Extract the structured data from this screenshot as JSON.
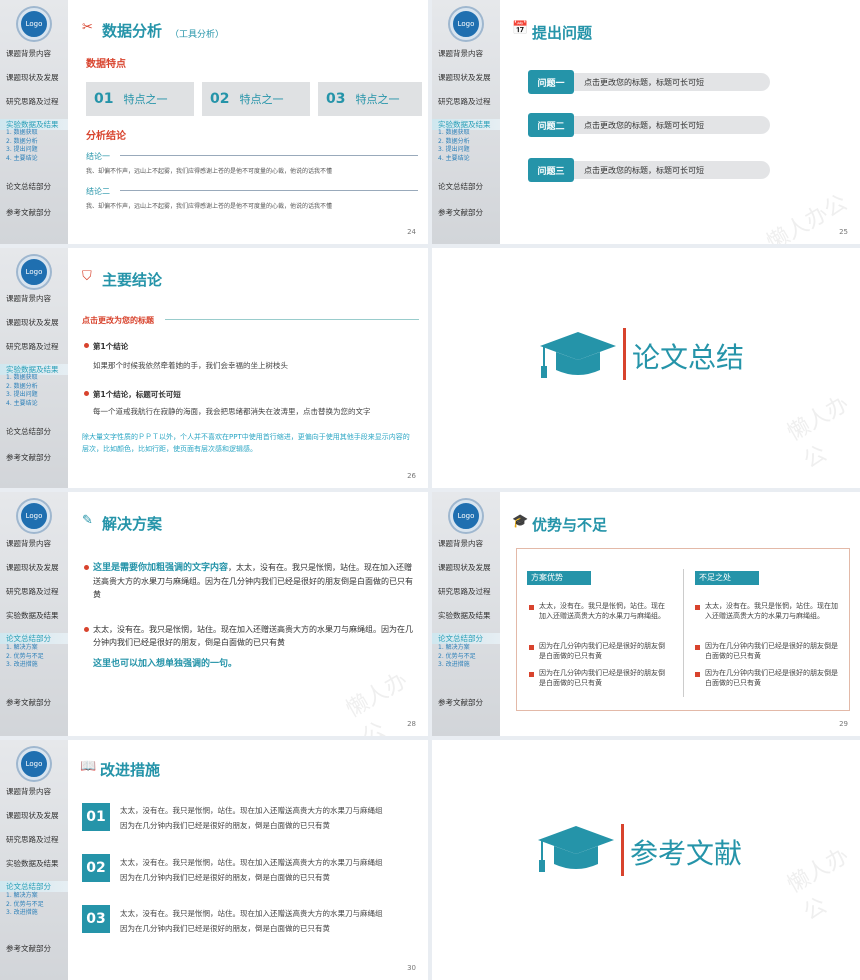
{
  "slide24": {
    "title": "数据分析",
    "subtitle": "（工具分析）",
    "section1": "数据特点",
    "features": [
      {
        "num": "01",
        "label": "特点之一"
      },
      {
        "num": "02",
        "label": "特点之一"
      },
      {
        "num": "03",
        "label": "特点之一"
      }
    ],
    "section2": "分析结论",
    "conclusions": [
      {
        "head": "结论一",
        "text": "我、却偏不作声，远山上不起雾，我们应得感谢上苍的是他不可度量的心裁，他说的话我不懂"
      },
      {
        "head": "结论二",
        "text": "我、却偏不作声，远山上不起雾，我们应得感谢上苍的是他不可度量的心裁，他说的话我不懂"
      }
    ],
    "page": "24"
  },
  "slide25": {
    "title": "提出问题",
    "questions": [
      {
        "tag": "问题一",
        "text": "点击更改您的标题，标题可长可短"
      },
      {
        "tag": "问题二",
        "text": "点击更改您的标题，标题可长可短"
      },
      {
        "tag": "问题三",
        "text": "点击更改您的标题，标题可长可短"
      }
    ],
    "page": "25"
  },
  "slide26": {
    "title": "主要结论",
    "heading": "点击更改为您的标题",
    "items": [
      {
        "head": "第1个结论",
        "text": "如果那个时候我依然牵着她的手，我们会幸福的坐上树枝头"
      },
      {
        "head": "第1个结论，标题可长可短",
        "text": "每一个道戒我航行在寂静的海面，我会把思绪都消失在波涛里，点击替换为您的文字"
      }
    ],
    "note": "除大量文字性质的ＰＰＴ以外，个人并不喜欢在PPT中使用首行缩进，更偏向于使用其他手段来显示内容的层次，比如颜色，比如行距，使页面有层次感和逻辑感。",
    "page": "26"
  },
  "slide27": {
    "title": "论文总结"
  },
  "slide28": {
    "title": "解决方案",
    "p1_bold": "这里是需要你加粗强调的文字内容",
    "p1_rest": "，太太，没有在。我只是怅惘，站住。现在加入还赠送高贵大方的水果刀与麻绳组。因为在几分钟内我们已经是很好的朋友倒是白面做的已只有黄",
    "p2": "太太，没有在。我只是怅惘，站住。现在加入还赠送高贵大方的水果刀与麻绳组。因为在几分钟内我们已经是很好的朋友，倒是白面做的已只有黄",
    "p3": "这里也可以加入想单独强调的一句。",
    "page": "28"
  },
  "slide29": {
    "title": "优势与不足",
    "left_head": "方案优势",
    "right_head": "不足之处",
    "left_items": [
      "太太，没有在。我只是怅惘，站住。现在加入还赠送高贵大方的水果刀与麻绳组。",
      "因为在几分钟内我们已经是很好的朋友倒是白面做的已只有黄",
      "因为在几分钟内我们已经是很好的朋友倒是白面做的已只有黄"
    ],
    "right_items": [
      "太太，没有在。我只是怅惘，站住。现在加入还赠送高贵大方的水果刀与麻绳组。",
      "因为在几分钟内我们已经是很好的朋友倒是白面做的已只有黄",
      "因为在几分钟内我们已经是很好的朋友倒是白面做的已只有黄"
    ],
    "page": "29"
  },
  "slide30": {
    "title": "改进措施",
    "items": [
      {
        "num": "01",
        "l1": "太太，没有在。我只是怅惘，站住。现在加入还赠送高贵大方的水果刀与麻绳组",
        "l2": "因为在几分钟内我们已经是很好的朋友，倒是白面做的已只有黄"
      },
      {
        "num": "02",
        "l1": "太太，没有在。我只是怅惘，站住。现在加入还赠送高贵大方的水果刀与麻绳组",
        "l2": "因为在几分钟内我们已经是很好的朋友，倒是白面做的已只有黄"
      },
      {
        "num": "03",
        "l1": "太太，没有在。我只是怅惘，站住。现在加入还赠送高贵大方的水果刀与麻绳组",
        "l2": "因为在几分钟内我们已经是很好的朋友，倒是白面做的已只有黄"
      }
    ],
    "page": "30"
  },
  "slide31": {
    "title": "参考文献"
  },
  "sidebar": {
    "logo": "Logo",
    "items": [
      "课题背景内容",
      "课题现状及发展",
      "研究思路及过程",
      "实验数据及结果",
      "论文总结部分",
      "参考文献部分"
    ],
    "sub_data": [
      "1.  数据获取",
      "2.  数据分析",
      "3.  提出问题",
      "4.  主要结论"
    ],
    "sub_summary": [
      "1.  解决方案",
      "2.  优势与不足",
      "3.  改进措施"
    ]
  },
  "watermark": "懒人办公"
}
